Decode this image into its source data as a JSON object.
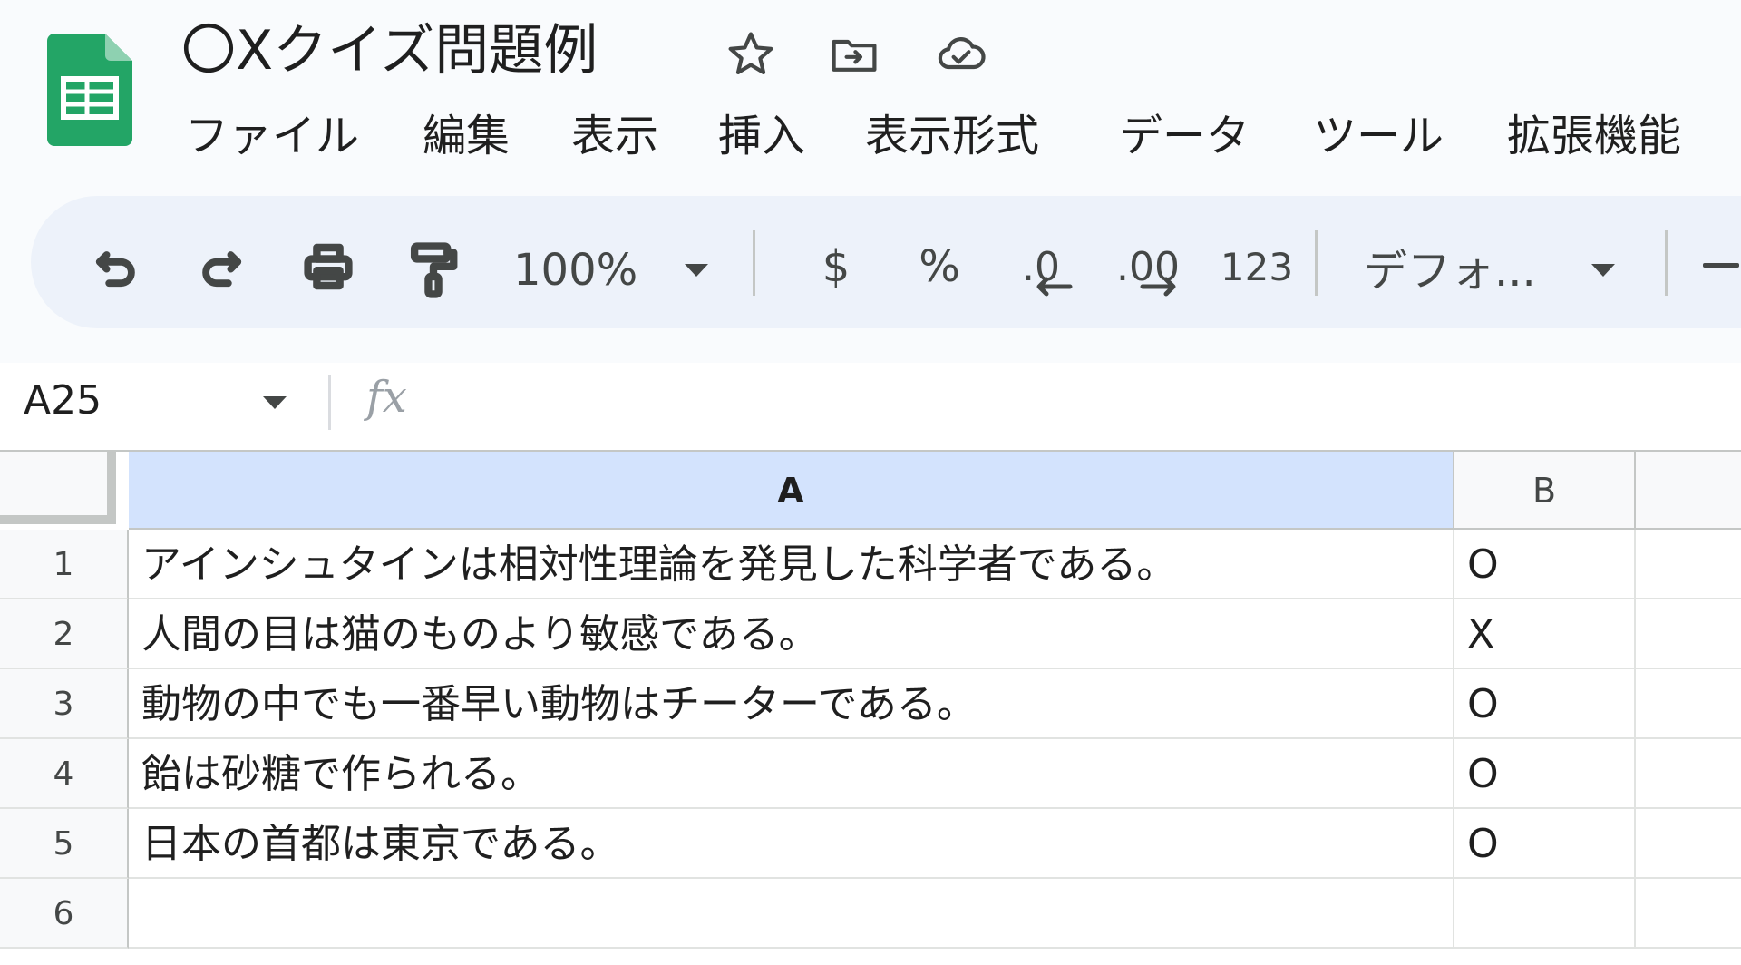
{
  "app": {
    "title": "〇Xクイズ問題例",
    "icons": [
      "star-icon",
      "move-to-folder-icon",
      "cloud-status-icon"
    ]
  },
  "menu": {
    "items": [
      "ファイル",
      "編集",
      "表示",
      "挿入",
      "表示形式",
      "データ",
      "ツール",
      "拡張機能"
    ]
  },
  "toolbar": {
    "undo_icon": "undo-icon",
    "redo_icon": "redo-icon",
    "print_icon": "print-icon",
    "paint_format_icon": "paint-format-icon",
    "zoom": "100%",
    "currency": "$",
    "percent": "%",
    "decrease_decimal": ".0",
    "increase_decimal": ".00",
    "number_format": "123",
    "font": "デフォ..."
  },
  "formula_bar": {
    "cell_ref": "A25",
    "fx": "fx",
    "value": ""
  },
  "grid": {
    "columns": [
      "A",
      "B"
    ],
    "selected_column": "A",
    "rows": [
      {
        "num": "1",
        "a": "アインシュタインは相対性理論を発見した科学者である。",
        "b": "O"
      },
      {
        "num": "2",
        "a": "人間の目は猫のものより敏感である。",
        "b": "X"
      },
      {
        "num": "3",
        "a": "動物の中でも一番早い動物はチーターである。",
        "b": "O"
      },
      {
        "num": "4",
        "a": "飴は砂糖で作られる。",
        "b": "O"
      },
      {
        "num": "5",
        "a": "日本の首都は東京である。",
        "b": "O"
      },
      {
        "num": "6",
        "a": "",
        "b": ""
      }
    ]
  },
  "colors": {
    "sheets_green": "#23a566",
    "toolbar_bg": "#edf2fa",
    "selected_header": "#d3e3fd"
  }
}
